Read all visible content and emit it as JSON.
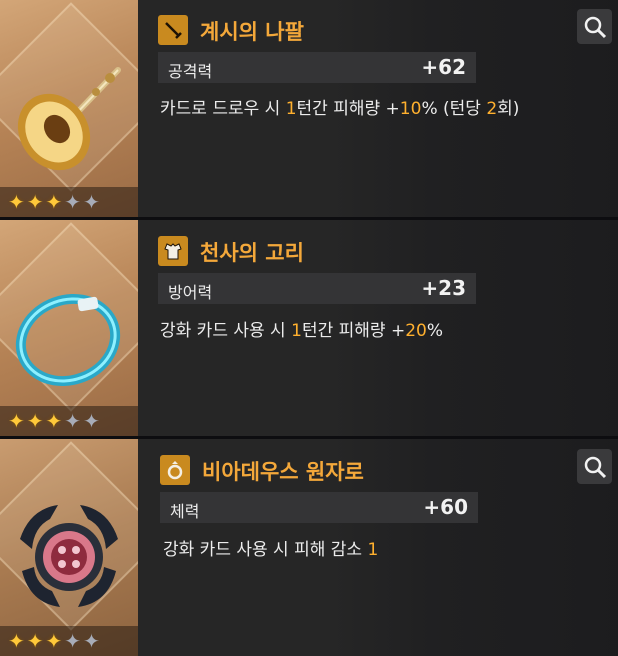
{
  "cards": [
    {
      "title": "계시의 나팔",
      "stat_label": "공격력",
      "stat_value": "+62",
      "desc": {
        "a": "카드로 드로우 시 ",
        "b": "1",
        "c": "턴간 피해량 +",
        "d": "10",
        "e": "% (턴당 ",
        "f": "2",
        "g": "회)"
      },
      "stars": {
        "filled": 3,
        "total": 5
      },
      "icon": "sword-icon"
    },
    {
      "title": "천사의 고리",
      "stat_label": "방어력",
      "stat_value": "+23",
      "desc": {
        "a": "강화 카드 사용 시 ",
        "b": "1",
        "c": "턴간 피해량 +",
        "d": "20",
        "e": "%"
      },
      "stars": {
        "filled": 3,
        "total": 5
      },
      "icon": "armor-icon"
    },
    {
      "title": "비아데우스 원자로",
      "stat_label": "체력",
      "stat_value": "+60",
      "desc": {
        "a": "강화 카드 사용 시 피해 감소 ",
        "b": "1"
      },
      "stars": {
        "filled": 3,
        "total": 5
      },
      "icon": "ring-icon"
    }
  ],
  "colors": {
    "accent": "#f4a83a",
    "highlight": "#ffb02e",
    "icon_bg": "#c98a1f",
    "panel": "#262626"
  }
}
